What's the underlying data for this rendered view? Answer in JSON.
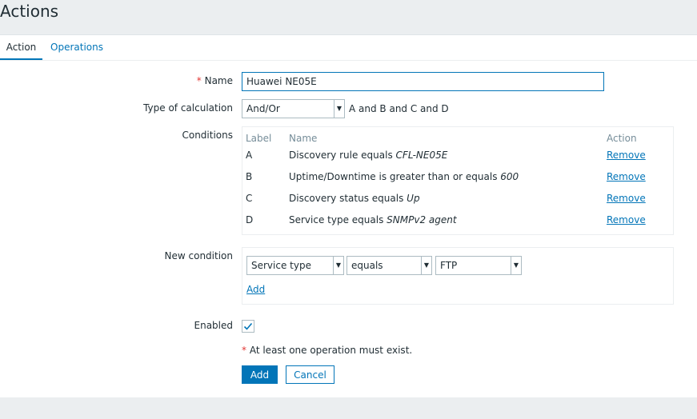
{
  "header": {
    "title": "Actions"
  },
  "tabs": [
    {
      "label": "Action"
    },
    {
      "label": "Operations"
    }
  ],
  "form": {
    "name_label": "Name",
    "required_mark": "*",
    "name_value": "Huawei NE05E",
    "calc_label": "Type of calculation",
    "calc_value": "And/Or",
    "calc_formula": "A and B and C and D",
    "conditions_label": "Conditions",
    "conditions": {
      "headers": {
        "label": "Label",
        "name": "Name",
        "action": "Action"
      },
      "rows": [
        {
          "label": "A",
          "text": "Discovery rule equals ",
          "value": "CFL-NE05E",
          "action": "Remove"
        },
        {
          "label": "B",
          "text": "Uptime/Downtime is greater than or equals ",
          "value": "600",
          "action": "Remove"
        },
        {
          "label": "C",
          "text": "Discovery status equals ",
          "value": "Up",
          "action": "Remove"
        },
        {
          "label": "D",
          "text": "Service type equals ",
          "value": "SNMPv2 agent",
          "action": "Remove"
        }
      ]
    },
    "new_condition_label": "New condition",
    "new_condition": {
      "type": "Service type",
      "operator": "equals",
      "value": "FTP",
      "add_label": "Add"
    },
    "enabled_label": "Enabled",
    "enabled": true,
    "note": "At least one operation must exist.",
    "add_button": "Add",
    "cancel_button": "Cancel"
  },
  "colors": {
    "accent": "#0275b8",
    "required": "#e33734",
    "background": "#ebeef0"
  }
}
